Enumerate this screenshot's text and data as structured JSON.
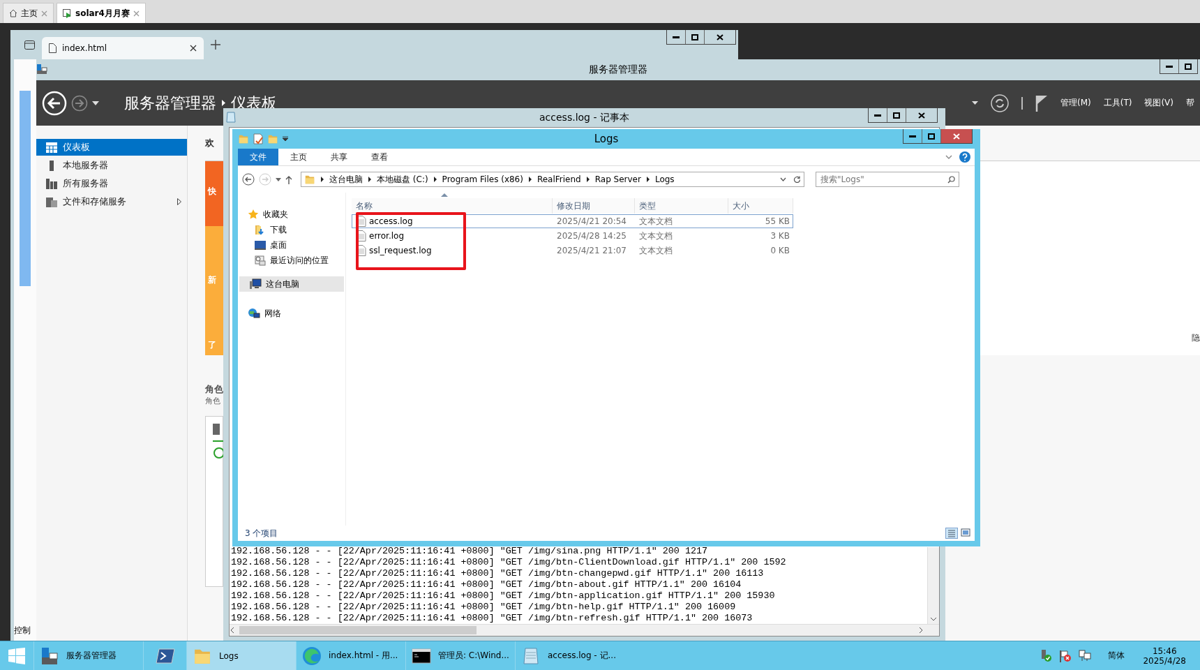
{
  "browser_tabs": [
    {
      "label": "主页",
      "selected": false
    },
    {
      "label": "solar4月月赛",
      "selected": true
    }
  ],
  "inner_browser": {
    "tab": "index.html",
    "side_text": "控制"
  },
  "server_manager": {
    "title": "服务器管理器",
    "breadcrumb": [
      "服务器管理器",
      "仪表板"
    ],
    "menu": [
      "管理(M)",
      "工具(T)",
      "视图(V)",
      "帮"
    ],
    "sidebar": [
      {
        "label": "仪表板",
        "selected": true,
        "has_submenu": false
      },
      {
        "label": "本地服务器",
        "selected": false,
        "has_submenu": false
      },
      {
        "label": "所有服务器",
        "selected": false,
        "has_submenu": false
      },
      {
        "label": "文件和存储服务",
        "selected": false,
        "has_submenu": true
      }
    ],
    "welcome": "欢",
    "tiles": [
      {
        "label": "快",
        "color": "#f26522"
      },
      {
        "label": "新",
        "color": "#fbad3b"
      },
      {
        "label": "了",
        "color": "#fbad3b"
      }
    ],
    "roles_title": "角色",
    "roles_subtitle": "角色",
    "hide_link": "隐"
  },
  "notepad": {
    "title": "access.log - 记事本",
    "lines": [
      "192.168.56.128 - - [22/Apr/2025:11:16:41 +0800] \"GET /img/sina.png HTTP/1.1\" 200 1217",
      "192.168.56.128 - - [22/Apr/2025:11:16:41 +0800] \"GET /img/btn-ClientDownload.gif HTTP/1.1\" 200 1592",
      "192.168.56.128 - - [22/Apr/2025:11:16:41 +0800] \"GET /img/btn-changepwd.gif HTTP/1.1\" 200 16113",
      "192.168.56.128 - - [22/Apr/2025:11:16:41 +0800] \"GET /img/btn-about.gif HTTP/1.1\" 200 16104",
      "192.168.56.128 - - [22/Apr/2025:11:16:41 +0800] \"GET /img/btn-application.gif HTTP/1.1\" 200 15930",
      "192.168.56.128 - - [22/Apr/2025:11:16:41 +0800] \"GET /img/btn-help.gif HTTP/1.1\" 200 16009",
      "192.168.56.128 - - [22/Apr/2025:11:16:41 +0800] \"GET /img/btn-refresh.gif HTTP/1.1\" 200 16073"
    ]
  },
  "explorer": {
    "title": "Logs",
    "ribbon_tabs": [
      {
        "label": "文件",
        "selected": true
      },
      {
        "label": "主页",
        "selected": false
      },
      {
        "label": "共享",
        "selected": false
      },
      {
        "label": "查看",
        "selected": false
      }
    ],
    "path": [
      "这台电脑",
      "本地磁盘 (C:)",
      "Program Files (x86)",
      "RealFriend",
      "Rap Server",
      "Logs"
    ],
    "search": {
      "placeholder": "搜索\"Logs\""
    },
    "nav": [
      {
        "label": "收藏夹",
        "kind": "star",
        "selected": false,
        "children": [
          {
            "label": "下载",
            "kind": "download",
            "selected": false
          },
          {
            "label": "桌面",
            "kind": "desktop",
            "selected": false
          },
          {
            "label": "最近访问的位置",
            "kind": "recent",
            "selected": false
          }
        ]
      },
      {
        "label": "这台电脑",
        "kind": "computer",
        "selected": true
      },
      {
        "label": "网络",
        "kind": "network",
        "selected": false
      }
    ],
    "columns": [
      "名称",
      "修改日期",
      "类型",
      "大小"
    ],
    "files": [
      {
        "name": "access.log",
        "date": "2025/4/21 20:54",
        "type": "文本文档",
        "size": "55 KB",
        "selected": true
      },
      {
        "name": "error.log",
        "date": "2025/4/28 14:25",
        "type": "文本文档",
        "size": "3 KB",
        "selected": false
      },
      {
        "name": "ssl_request.log",
        "date": "2025/4/21 21:07",
        "type": "文本文档",
        "size": "0 KB",
        "selected": false
      }
    ],
    "status": "3 个项目"
  },
  "taskbar": {
    "items": [
      {
        "kind": "server",
        "label": "服务器管理器",
        "active": false
      },
      {
        "kind": "powershell",
        "active": false
      },
      {
        "kind": "folder",
        "label": "Logs",
        "active": true
      },
      {
        "kind": "edge",
        "label": "index.html - 用...",
        "active": false
      },
      {
        "kind": "cmd",
        "label": "管理员: C:\\Wind...",
        "active": false
      },
      {
        "kind": "notepad",
        "label": "access.log - 记...",
        "active": false
      }
    ],
    "ime": "简体",
    "time": "15:46",
    "date": "2025/4/28"
  }
}
